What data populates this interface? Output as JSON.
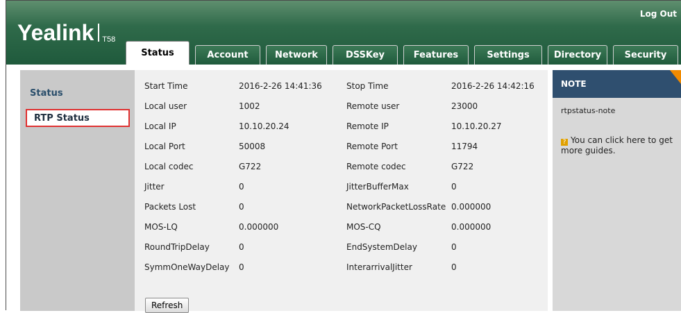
{
  "header": {
    "logo": "Yealink",
    "model": "T58",
    "logout": "Log Out"
  },
  "tabs": [
    {
      "label": "Status",
      "active": true
    },
    {
      "label": "Account"
    },
    {
      "label": "Network"
    },
    {
      "label": "DSSKey"
    },
    {
      "label": "Features"
    },
    {
      "label": "Settings"
    },
    {
      "label": "Directory"
    },
    {
      "label": "Security"
    }
  ],
  "sidebar": {
    "items": [
      {
        "label": "Status"
      },
      {
        "label": "RTP Status",
        "selected": true
      }
    ]
  },
  "rtp": {
    "rows": [
      {
        "label1": "Start Time",
        "value1": "2016-2-26 14:41:36",
        "label2": "Stop Time",
        "value2": "2016-2-26 14:42:16"
      },
      {
        "label1": "Local user",
        "value1": "1002",
        "label2": "Remote user",
        "value2": "23000"
      },
      {
        "label1": "Local IP",
        "value1": "10.10.20.24",
        "label2": "Remote IP",
        "value2": "10.10.20.27"
      },
      {
        "label1": "Local Port",
        "value1": "50008",
        "label2": "Remote Port",
        "value2": "11794"
      },
      {
        "label1": "Local codec",
        "value1": "G722",
        "label2": "Remote codec",
        "value2": "G722"
      },
      {
        "label1": "Jitter",
        "value1": "0",
        "label2": "JitterBufferMax",
        "value2": "0"
      },
      {
        "label1": "Packets Lost",
        "value1": "0",
        "label2": "NetworkPacketLossRate",
        "value2": "0.000000"
      },
      {
        "label1": "MOS-LQ",
        "value1": "0.000000",
        "label2": "MOS-CQ",
        "value2": "0.000000"
      },
      {
        "label1": "RoundTripDelay",
        "value1": "0",
        "label2": "EndSystemDelay",
        "value2": "0"
      },
      {
        "label1": "SymmOneWayDelay",
        "value1": "0",
        "label2": "InterarrivalJitter",
        "value2": "0"
      }
    ],
    "refresh_label": "Refresh"
  },
  "note": {
    "title": "NOTE",
    "text": "rtpstatus-note",
    "guide_icon": "?",
    "guide_text": "You can click here to get more guides."
  }
}
